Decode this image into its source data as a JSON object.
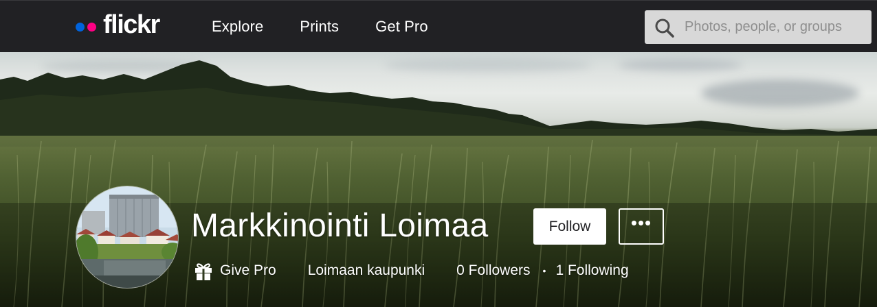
{
  "colors": {
    "nav_background": "#212124",
    "logo_blue": "#0063dc",
    "logo_pink": "#ff0084",
    "search_background": "#d8d8d8",
    "follow_button_background": "#ffffff"
  },
  "header": {
    "logo_text": "flickr",
    "nav": [
      {
        "label": "Explore"
      },
      {
        "label": "Prints"
      },
      {
        "label": "Get Pro"
      }
    ],
    "search": {
      "placeholder": "Photos, people, or groups",
      "icon": "search-icon"
    }
  },
  "profile": {
    "name": "Markkinointi Loimaa",
    "follow_label": "Follow",
    "more_label": "•••",
    "give_pro_label": "Give Pro",
    "give_pro_icon": "gift-icon",
    "real_name": "Loimaan kaupunki",
    "followers": "0 Followers",
    "separator": "•",
    "following": "1 Following"
  }
}
